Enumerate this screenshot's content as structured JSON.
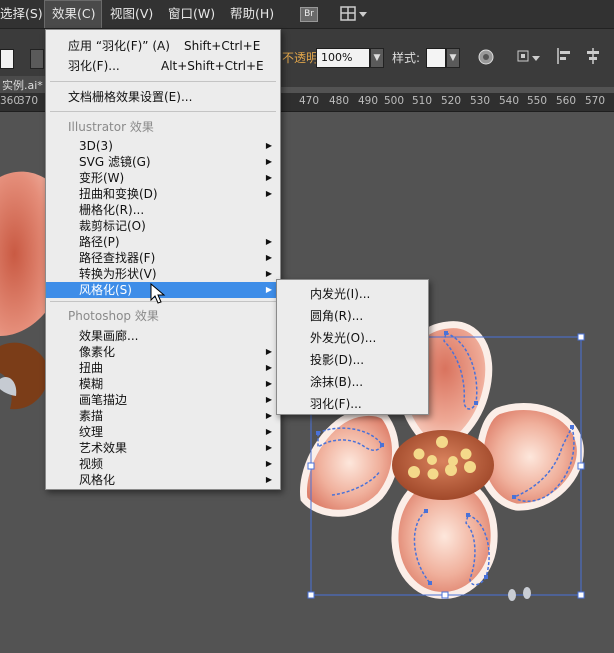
{
  "menubar": {
    "items": [
      "选择(S)",
      "效果(C)",
      "视图(V)",
      "窗口(W)",
      "帮助(H)"
    ],
    "br_label": "Br"
  },
  "controlbar": {
    "opacity_label": "不透明度:",
    "opacity_value": "100%",
    "style_label": "样式:"
  },
  "document": {
    "tab_title": "实例.ai* @"
  },
  "ruler": {
    "ticks": [
      "360",
      "370",
      "470",
      "480",
      "490",
      "500",
      "510",
      "520",
      "530",
      "540",
      "550",
      "560",
      "570"
    ]
  },
  "effect_menu": {
    "apply_label": "应用 “羽化(F)” (A)",
    "apply_shortcut": "Shift+Ctrl+E",
    "feather_label": "羽化(F)...",
    "feather_shortcut": "Alt+Shift+Ctrl+E",
    "raster_settings_label": "文档栅格效果设置(E)...",
    "illustrator_header": "Illustrator 效果",
    "illustrator_items": [
      "3D(3)",
      "SVG 滤镜(G)",
      "变形(W)",
      "扭曲和变换(D)",
      "栅格化(R)...",
      "裁剪标记(O)",
      "路径(P)",
      "路径查找器(F)",
      "转换为形状(V)",
      "风格化(S)"
    ],
    "photoshop_header": "Photoshop 效果",
    "photoshop_items": [
      "效果画廊...",
      "像素化",
      "扭曲",
      "模糊",
      "画笔描边",
      "素描",
      "纹理",
      "艺术效果",
      "视频",
      "风格化"
    ]
  },
  "stylize_submenu": {
    "items": [
      "内发光(I)...",
      "圆角(R)...",
      "外发光(O)...",
      "投影(D)...",
      "涂抹(B)...",
      "羽化(F)..."
    ]
  },
  "colors": {
    "menu_highlight": "#3e8de8",
    "selection_blue": "#4a72d8",
    "petal_pink": "#e8a592",
    "center_brown": "#b65a38",
    "stamen_yellow": "#f4d98a"
  }
}
